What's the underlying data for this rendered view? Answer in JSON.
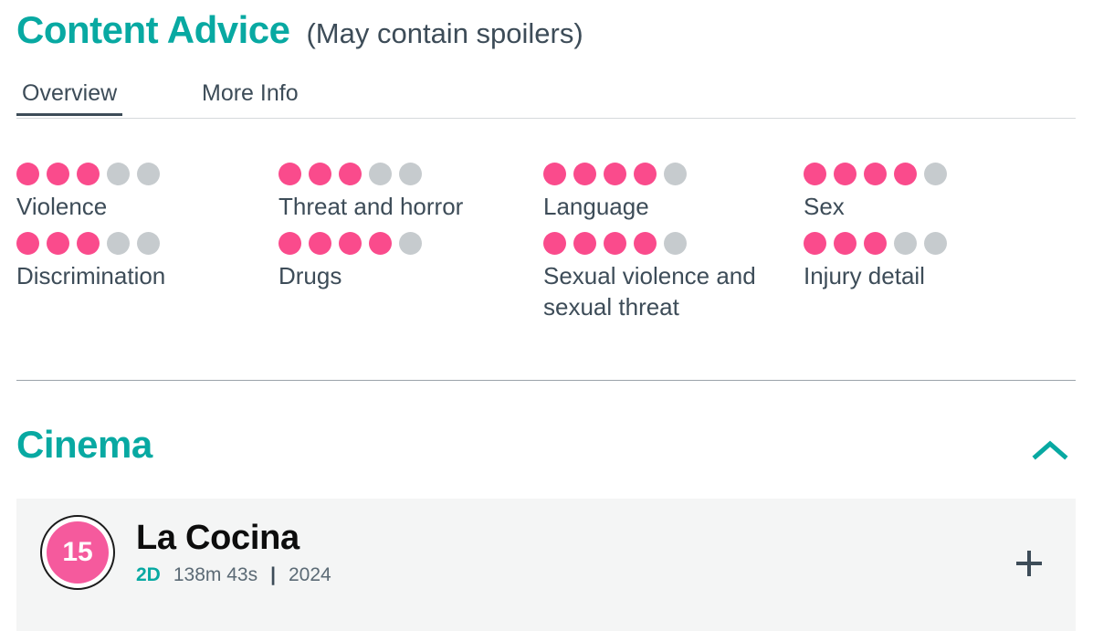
{
  "header": {
    "title": "Content Advice",
    "subtitle": "(May contain spoilers)"
  },
  "tabs": [
    {
      "label": "Overview",
      "active": true
    },
    {
      "label": "More Info",
      "active": false
    }
  ],
  "advice": {
    "max_rating": 5,
    "items": [
      {
        "label": "Violence",
        "rating": 3
      },
      {
        "label": "Threat and horror",
        "rating": 3
      },
      {
        "label": "Language",
        "rating": 4
      },
      {
        "label": "Sex",
        "rating": 4
      },
      {
        "label": "Discrimination",
        "rating": 3
      },
      {
        "label": "Drugs",
        "rating": 4
      },
      {
        "label": "Sexual violence and sexual threat",
        "rating": 4
      },
      {
        "label": "Injury detail",
        "rating": 3
      }
    ]
  },
  "cinema": {
    "title": "Cinema",
    "collapse_icon": "chevron-up-icon",
    "film": {
      "certificate": "15",
      "title": "La Cocina",
      "format": "2D",
      "duration": "138m 43s",
      "separator": "|",
      "year": "2024",
      "add_icon": "plus-icon"
    }
  },
  "colors": {
    "teal": "#08a9a2",
    "pink": "#fa4b8c",
    "badge_pink": "#f55a9d",
    "dot_off": "#c6cbce",
    "text": "#3d4c58",
    "card_bg": "#f4f5f5"
  }
}
